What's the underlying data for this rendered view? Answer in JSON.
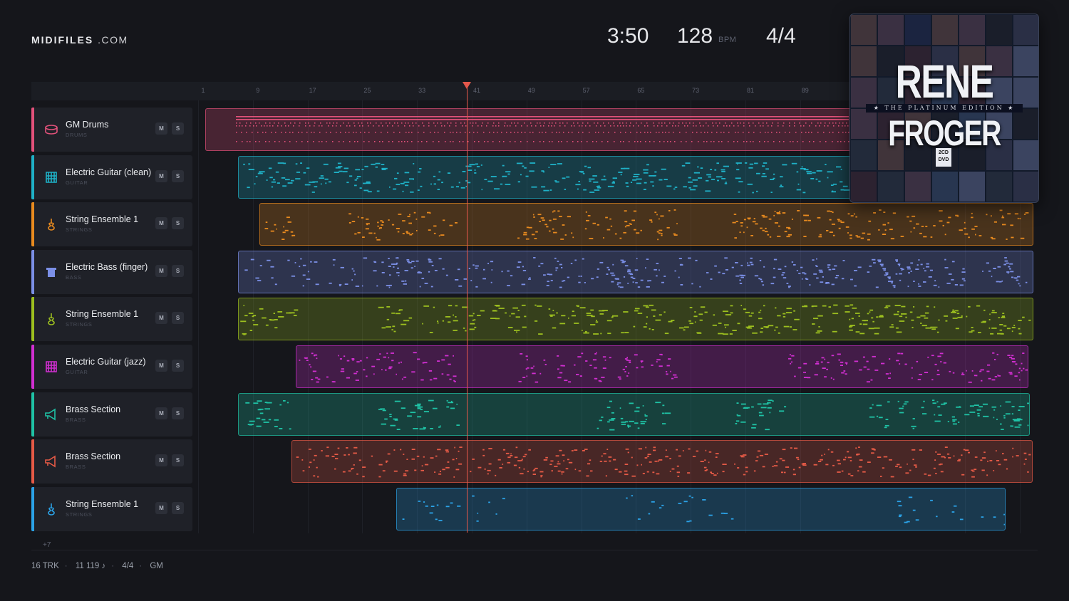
{
  "brand": {
    "name": "MIDIFILES",
    "suffix": ".COM"
  },
  "header": {
    "duration": "3:50",
    "bpm": "128",
    "bpm_unit": "BPM",
    "time_signature": "4/4"
  },
  "ruler": {
    "labels": [
      "1",
      "9",
      "17",
      "25",
      "33",
      "41",
      "49",
      "57",
      "65",
      "73",
      "81",
      "89"
    ]
  },
  "colors": {
    "background": "#15161b",
    "playhead": "#e4574b",
    "panel": "#1f2128"
  },
  "tracks": [
    {
      "name": "GM Drums",
      "category": "DRUMS",
      "color": "#e2517a",
      "icon": "drum-icon",
      "mute": "M",
      "solo": "S"
    },
    {
      "name": "Electric Guitar (clean)",
      "category": "GUITAR",
      "color": "#1fb1c7",
      "icon": "guitar-icon",
      "mute": "M",
      "solo": "S"
    },
    {
      "name": "String Ensemble 1",
      "category": "STRINGS",
      "color": "#e88a1f",
      "icon": "violin-icon",
      "mute": "M",
      "solo": "S"
    },
    {
      "name": "Electric Bass (finger)",
      "category": "BASS",
      "color": "#7b8fe6",
      "icon": "bass-icon",
      "mute": "M",
      "solo": "S"
    },
    {
      "name": "String Ensemble 1",
      "category": "STRINGS",
      "color": "#9cbf1f",
      "icon": "violin-icon",
      "mute": "M",
      "solo": "S"
    },
    {
      "name": "Electric Guitar (jazz)",
      "category": "GUITAR",
      "color": "#d12fd1",
      "icon": "guitar-icon",
      "mute": "M",
      "solo": "S"
    },
    {
      "name": "Brass Section",
      "category": "BRASS",
      "color": "#1fc2a5",
      "icon": "trumpet-icon",
      "mute": "M",
      "solo": "S"
    },
    {
      "name": "Brass Section",
      "category": "BRASS",
      "color": "#e55a46",
      "icon": "trumpet-icon",
      "mute": "M",
      "solo": "S"
    },
    {
      "name": "String Ensemble 1",
      "category": "STRINGS",
      "color": "#2ba3e8",
      "icon": "violin-icon",
      "mute": "M",
      "solo": "S"
    }
  ],
  "more_tracks": "+7",
  "footer": {
    "tracks": "16 TRK",
    "notes": "11 119 ♪",
    "time_signature": "4/4",
    "standard": "GM"
  },
  "album": {
    "artist": "RENE",
    "title": "FROGER",
    "edition": "★ THE PLATINUM EDITION ★",
    "badge": "2CD DVD"
  }
}
